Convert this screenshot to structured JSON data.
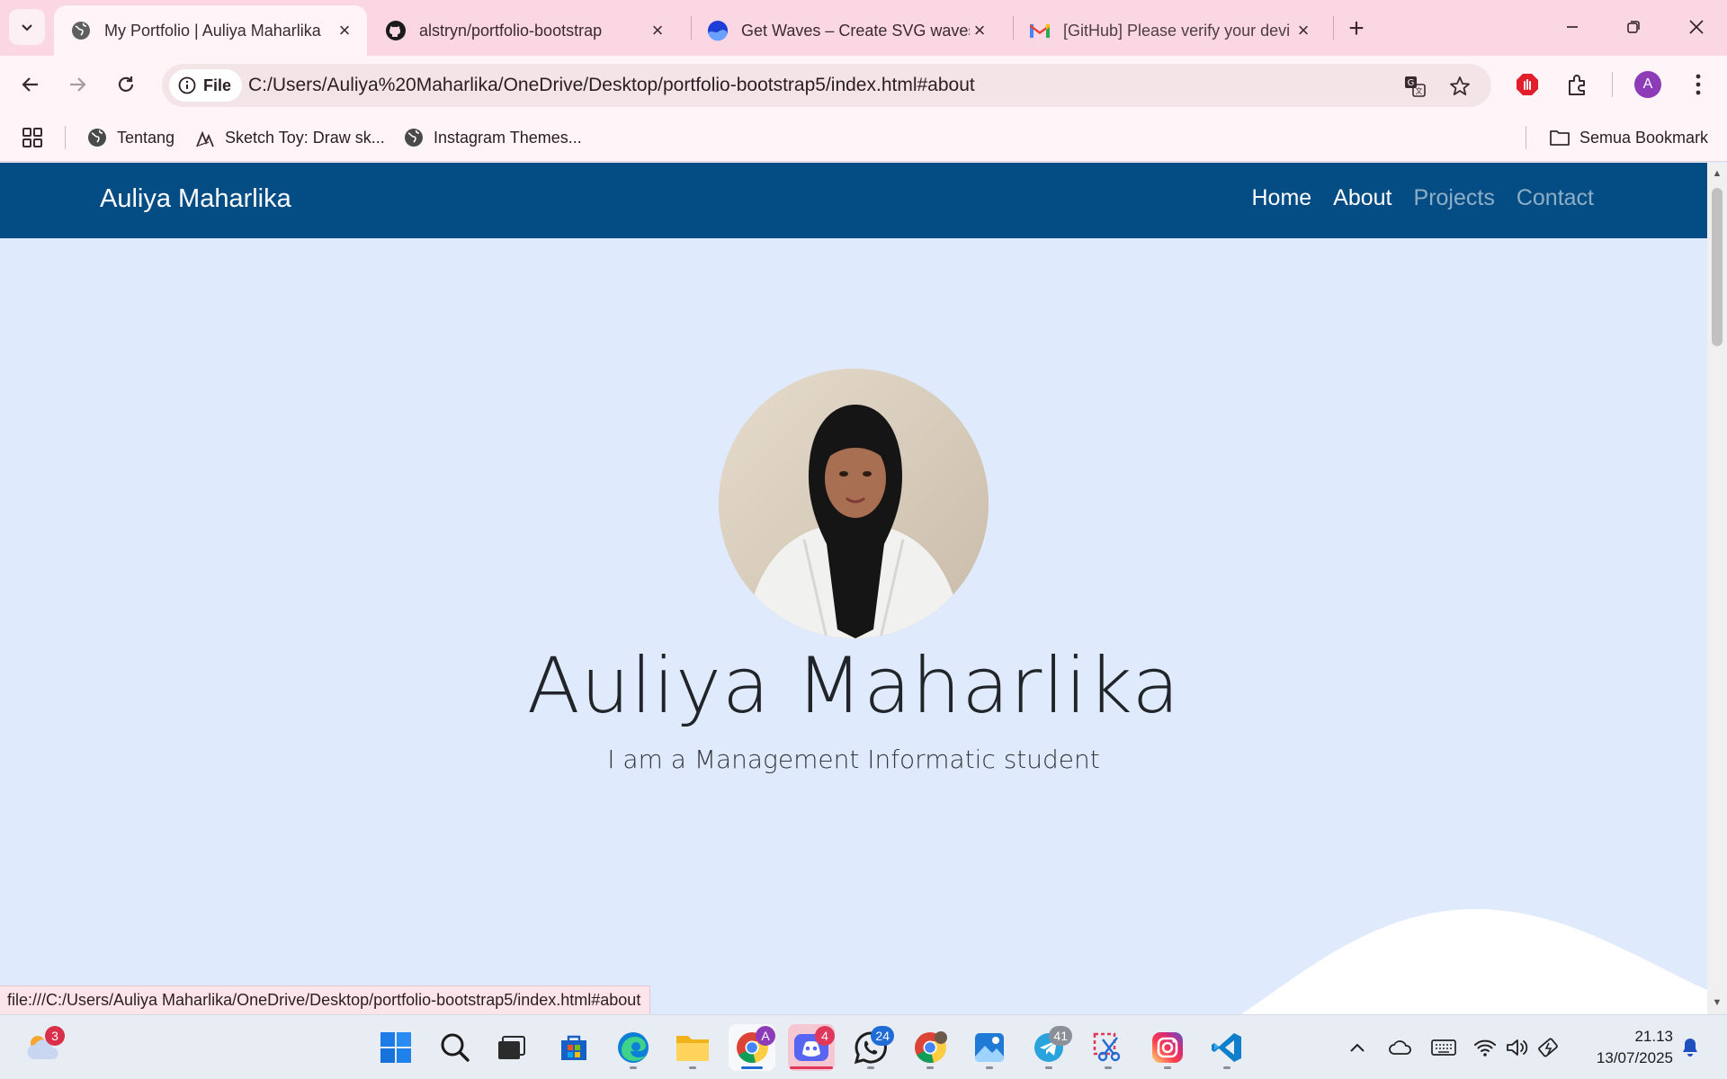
{
  "browser": {
    "tabs": [
      {
        "title": "My Portfolio | Auliya Maharlika",
        "icon": "globe-icon",
        "active": true
      },
      {
        "title": "alstryn/portfolio-bootstrap",
        "icon": "github-icon",
        "active": false
      },
      {
        "title": "Get Waves – Create SVG waves",
        "icon": "waves-icon",
        "active": false
      },
      {
        "title": "[GitHub] Please verify your devi",
        "icon": "gmail-icon",
        "active": false
      }
    ],
    "address": {
      "chip_label": "File",
      "url": "C:/Users/Auliya%20Maharlika/OneDrive/Desktop/portfolio-bootstrap5/index.html#about"
    },
    "profile_initial": "A",
    "bookmarks": [
      {
        "label": "Tentang",
        "icon": "globe-icon"
      },
      {
        "label": "Sketch Toy: Draw sk...",
        "icon": "sketch-icon"
      },
      {
        "label": "Instagram Themes...",
        "icon": "globe-icon"
      }
    ],
    "all_bookmarks_label": "Semua Bookmark",
    "status_url": "file:///C:/Users/Auliya Maharlika/OneDrive/Desktop/portfolio-bootstrap5/index.html#about"
  },
  "page": {
    "brand": "Auliya Maharlika",
    "nav": [
      {
        "label": "Home",
        "active": true
      },
      {
        "label": "About",
        "active": true
      },
      {
        "label": "Projects",
        "active": false
      },
      {
        "label": "Contact",
        "active": false
      }
    ],
    "hero_name": "Auliya Maharlika",
    "hero_subtitle": "I am a Management Informatic student",
    "colors": {
      "navbar": "#044c84",
      "background": "#dfeafc"
    }
  },
  "taskbar": {
    "weather_badge": "3",
    "apps": [
      {
        "name": "start",
        "icon": "windows-icon"
      },
      {
        "name": "search",
        "icon": "search-icon"
      },
      {
        "name": "task-view",
        "icon": "task-view-icon"
      },
      {
        "name": "store",
        "icon": "store-icon"
      },
      {
        "name": "edge",
        "icon": "edge-icon"
      },
      {
        "name": "file-explorer",
        "icon": "folder-icon"
      },
      {
        "name": "chrome",
        "icon": "chrome-icon",
        "badge": "A"
      },
      {
        "name": "discord",
        "icon": "discord-icon",
        "badge": "4"
      },
      {
        "name": "whatsapp",
        "icon": "whatsapp-icon",
        "badge": "24"
      },
      {
        "name": "chrome-profile-2",
        "icon": "chrome-icon"
      },
      {
        "name": "photos",
        "icon": "photos-icon"
      },
      {
        "name": "telegram",
        "icon": "telegram-icon",
        "badge": "41"
      },
      {
        "name": "snipping-tool",
        "icon": "snipping-icon"
      },
      {
        "name": "instagram",
        "icon": "instagram-icon"
      },
      {
        "name": "vscode",
        "icon": "vscode-icon"
      }
    ],
    "time": "21.13",
    "date": "13/07/2025"
  }
}
